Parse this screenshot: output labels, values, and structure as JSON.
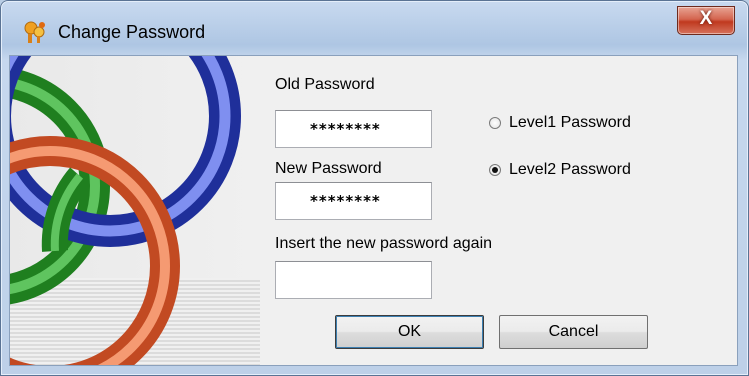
{
  "window": {
    "title": "Change Password",
    "close_label": "X"
  },
  "form": {
    "old_password_label": "Old Password",
    "old_password_value": "********",
    "new_password_label": "New Password",
    "new_password_value": "********",
    "confirm_label": "Insert the new password again",
    "confirm_value": ""
  },
  "level": {
    "option1_label": "Level1 Password",
    "option2_label": "Level2 Password",
    "selected": "Level2 Password"
  },
  "buttons": {
    "ok_label": "OK",
    "cancel_label": "Cancel"
  },
  "colors": {
    "ring_green": "#2e9a2e",
    "ring_blue": "#3046b8",
    "ring_orange": "#e0603a",
    "close_red": "#c0391f"
  }
}
